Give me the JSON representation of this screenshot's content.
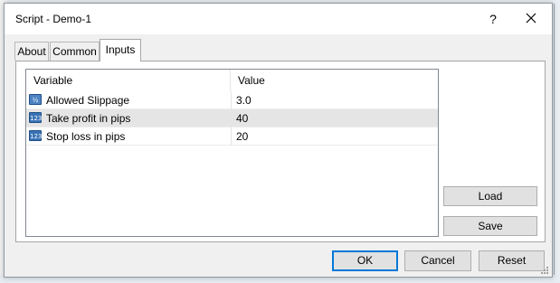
{
  "dialog": {
    "title": "Script - Demo-1",
    "help_glyph": "?",
    "close_icon": "close-icon"
  },
  "tabs": [
    {
      "label": "About",
      "active": false
    },
    {
      "label": "Common",
      "active": false
    },
    {
      "label": "Inputs",
      "active": true
    }
  ],
  "inputs_table": {
    "columns": [
      "Variable",
      "Value"
    ],
    "rows": [
      {
        "icon": "fraction-type-icon",
        "icon_text": "½",
        "variable": "Allowed Slippage",
        "value": "3.0",
        "selected": false
      },
      {
        "icon": "integer-type-icon",
        "icon_text": "123",
        "variable": "Take profit in pips",
        "value": "40",
        "selected": true
      },
      {
        "icon": "integer-type-icon",
        "icon_text": "123",
        "variable": "Stop loss in pips",
        "value": "20",
        "selected": false
      }
    ]
  },
  "side_buttons": {
    "load": "Load",
    "save": "Save"
  },
  "footer_buttons": {
    "ok": "OK",
    "cancel": "Cancel",
    "reset": "Reset"
  },
  "colors": {
    "accent": "#0078d7",
    "selected_row": "#e5e5e5",
    "panel": "#f0f0f0"
  }
}
